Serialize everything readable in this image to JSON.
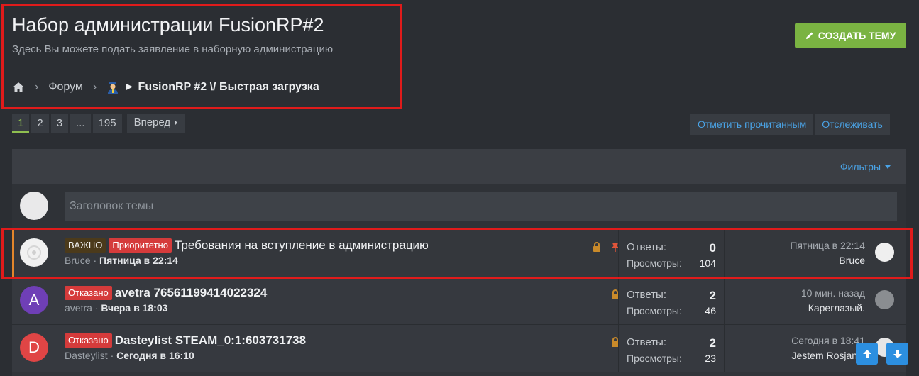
{
  "page": {
    "title": "Набор администрации FusionRP#2",
    "description": "Здесь Вы можете подать заявление в наборную администрацию"
  },
  "breadcrumb": {
    "home_icon": "home-icon",
    "items": [
      "Форум",
      "► FusionRP #2 \\/ Быстрая загрузка"
    ]
  },
  "actions": {
    "create_thread": "СОЗДАТЬ ТЕМУ",
    "mark_read": "Отметить прочитанным",
    "watch": "Отслеживать"
  },
  "pagination": {
    "pages": [
      "1",
      "2",
      "3",
      "...",
      "195"
    ],
    "current": "1",
    "next": "Вперед"
  },
  "filters": {
    "label": "Фильтры"
  },
  "new_thread": {
    "placeholder": "Заголовок темы"
  },
  "threads": [
    {
      "prefixes": [
        "ВАЖНО",
        "Приоритетно"
      ],
      "title": "Требования на вступление в администрацию",
      "author": "Bruce",
      "date": "Пятница в 22:14",
      "replies_label": "Ответы:",
      "replies": "0",
      "views_label": "Просмотры:",
      "views": "104",
      "last_time": "Пятница в 22:14",
      "last_user": "Bruce",
      "avatar_letter": ""
    },
    {
      "prefixes": [
        "Отказано"
      ],
      "title": "avetra 76561199414022324",
      "author": "avetra",
      "date": "Вчера в 18:03",
      "replies_label": "Ответы:",
      "replies": "2",
      "views_label": "Просмотры:",
      "views": "46",
      "last_time": "10 мин. назад",
      "last_user": "Кареглазый.",
      "avatar_letter": "A",
      "avatar_color": "#6f3fb6"
    },
    {
      "prefixes": [
        "Отказано"
      ],
      "title": "Dasteylist STEAM_0:1:603731738",
      "author": "Dasteylist",
      "date": "Сегодня в 16:10",
      "replies_label": "Ответы:",
      "replies": "2",
      "views_label": "Просмотры:",
      "views": "23",
      "last_time": "Сегодня в 18:41",
      "last_user": "Jestem Rosjanie",
      "avatar_letter": "D",
      "avatar_color": "#e04545"
    }
  ],
  "colors": {
    "accent_green": "#7ab342",
    "link_blue": "#4aa3e6",
    "badge_red": "#d53b3b",
    "highlight": "#e01b1b"
  }
}
